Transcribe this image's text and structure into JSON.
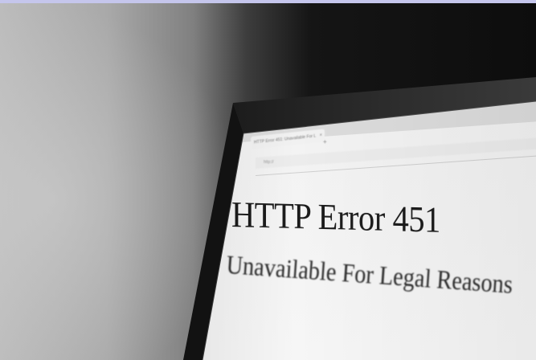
{
  "photo": {
    "subject": "monitor",
    "colors": {
      "wall_light": "#bcbcbc",
      "room_dark": "#0d0d0d",
      "screen_bg": "#f4f4f4",
      "text_dark": "#1b1b1b",
      "top_strip": "#c5c6ec"
    }
  },
  "browser": {
    "tab_title": "HTTP Error 451: Unavailable For L",
    "tab_close": "×",
    "new_tab": "+",
    "address": "http://"
  },
  "page": {
    "headline": "HTTP Error 451",
    "subline": "Unavailable For Legal Reasons"
  }
}
